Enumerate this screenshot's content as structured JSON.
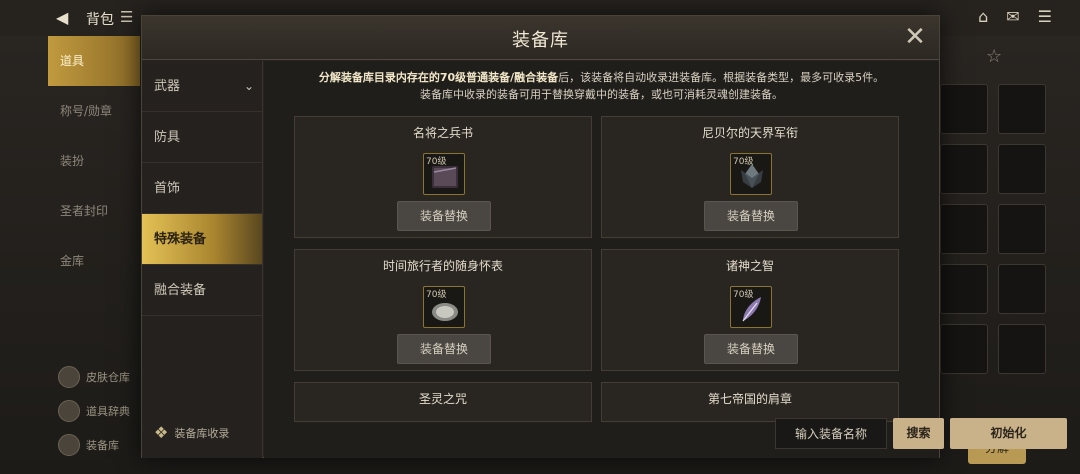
{
  "background": {
    "title": "背包",
    "sidebar_items": [
      "道具",
      "称号/勋章",
      "装扮",
      "圣者封印",
      "金库"
    ],
    "bottom_items": [
      "皮肤仓库",
      "道具辞典",
      "装备库"
    ],
    "decompose_label": "分解"
  },
  "modal": {
    "title": "装备库",
    "close_label": "✕"
  },
  "tabs": [
    {
      "label": "武器",
      "chevron": "⌄"
    },
    {
      "label": "防具"
    },
    {
      "label": "首饰"
    },
    {
      "label": "特殊装备"
    },
    {
      "label": "融合装备"
    }
  ],
  "footer_label": "装备库收录",
  "description": {
    "line1_bold": "分解装备库目录内存在的70级普通装备/融合装备",
    "line1_rest": "后，该装备将自动收录进装备库。根据装备类型，最多可收录5件。",
    "line2": "装备库中收录的装备可用于替换穿戴中的装备，或也可消耗灵魂创建装备。"
  },
  "cards": [
    {
      "name": "名将之兵书",
      "level": "70级",
      "button": "装备替换",
      "icon": "book-icon"
    },
    {
      "name": "尼贝尔的天界军衔",
      "level": "70级",
      "button": "装备替换",
      "icon": "insignia-icon"
    },
    {
      "name": "时间旅行者的随身怀表",
      "level": "70级",
      "button": "装备替换",
      "icon": "pocket-watch-icon"
    },
    {
      "name": "诸神之智",
      "level": "70级",
      "button": "装备替换",
      "icon": "feather-icon"
    },
    {
      "name": "圣灵之咒"
    },
    {
      "name": "第七帝国的肩章"
    }
  ],
  "search": {
    "placeholder": "输入装备名称",
    "search_label": "搜索",
    "reset_label": "初始化"
  },
  "colors": {
    "accent_gold": "#c9b28a",
    "active_tab": "#e4c256"
  }
}
